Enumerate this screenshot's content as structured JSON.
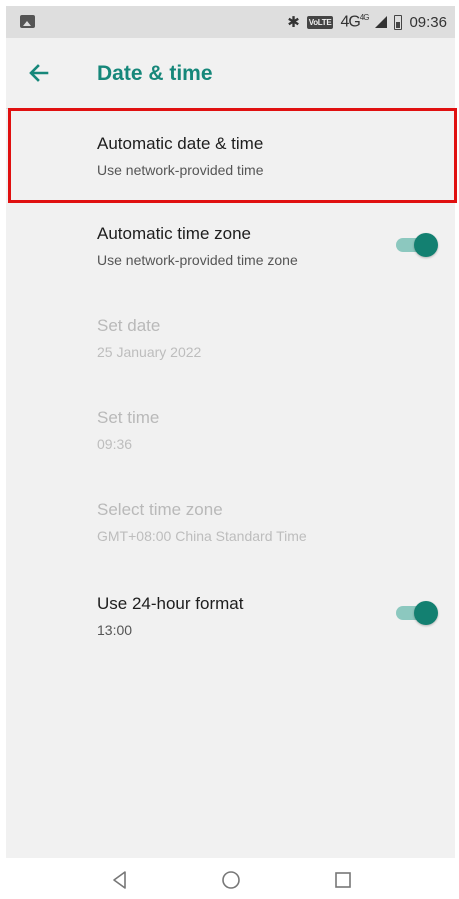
{
  "status_bar": {
    "network_label": "4G",
    "network_superscript": "4G",
    "volte_label": "VoLTE",
    "time": "09:36"
  },
  "toolbar": {
    "title": "Date & time",
    "accent_color": "#16877a"
  },
  "settings": [
    {
      "id": "automatic-date-time",
      "title": "Automatic date & time",
      "subtitle": "Use network-provided time",
      "enabled": true,
      "highlighted": true
    },
    {
      "id": "automatic-time-zone",
      "title": "Automatic time zone",
      "subtitle": "Use network-provided time zone",
      "enabled": true,
      "toggle": true,
      "toggle_on": true
    },
    {
      "id": "set-date",
      "title": "Set date",
      "subtitle": "25 January 2022",
      "enabled": false
    },
    {
      "id": "set-time",
      "title": "Set time",
      "subtitle": "09:36",
      "enabled": false
    },
    {
      "id": "select-time-zone",
      "title": "Select time zone",
      "subtitle": "GMT+08:00 China Standard Time",
      "enabled": false
    },
    {
      "id": "use-24-hour-format",
      "title": "Use 24-hour format",
      "subtitle": "13:00",
      "enabled": true,
      "toggle": true,
      "toggle_on": true
    }
  ],
  "highlight_color": "#e01010",
  "nav_bar": {
    "icons": [
      "back-triangle-icon",
      "home-circle-icon",
      "recents-square-icon"
    ]
  }
}
